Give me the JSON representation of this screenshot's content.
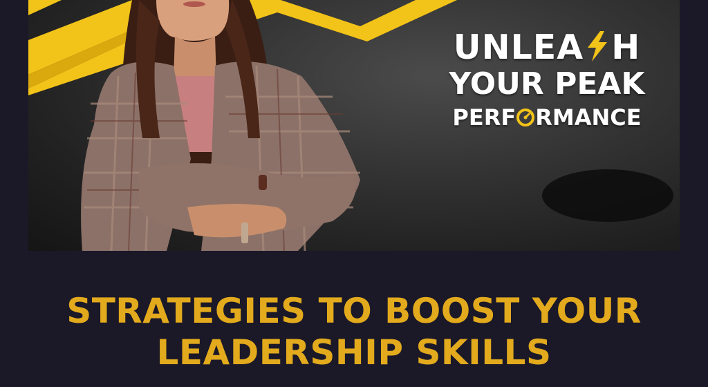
{
  "colors": {
    "page_background": "#1b1828",
    "accent_yellow": "#f2c318",
    "headline_text": "#ffffff",
    "caption_text": "#e2aa1c"
  },
  "hero": {
    "headline": {
      "line1_a": "UNLEA",
      "line1_b": "H",
      "line2": "YOUR PEAK",
      "line3_a": "PERF",
      "line3_b": "RMANCE"
    },
    "icons": [
      "lightning-bolt-icon",
      "speedometer-icon"
    ],
    "photo": "woman-crossed-arms-photo"
  },
  "caption": {
    "line1": "STRATEGIES TO BOOST YOUR",
    "line2": "LEADERSHIP SKILLS"
  }
}
